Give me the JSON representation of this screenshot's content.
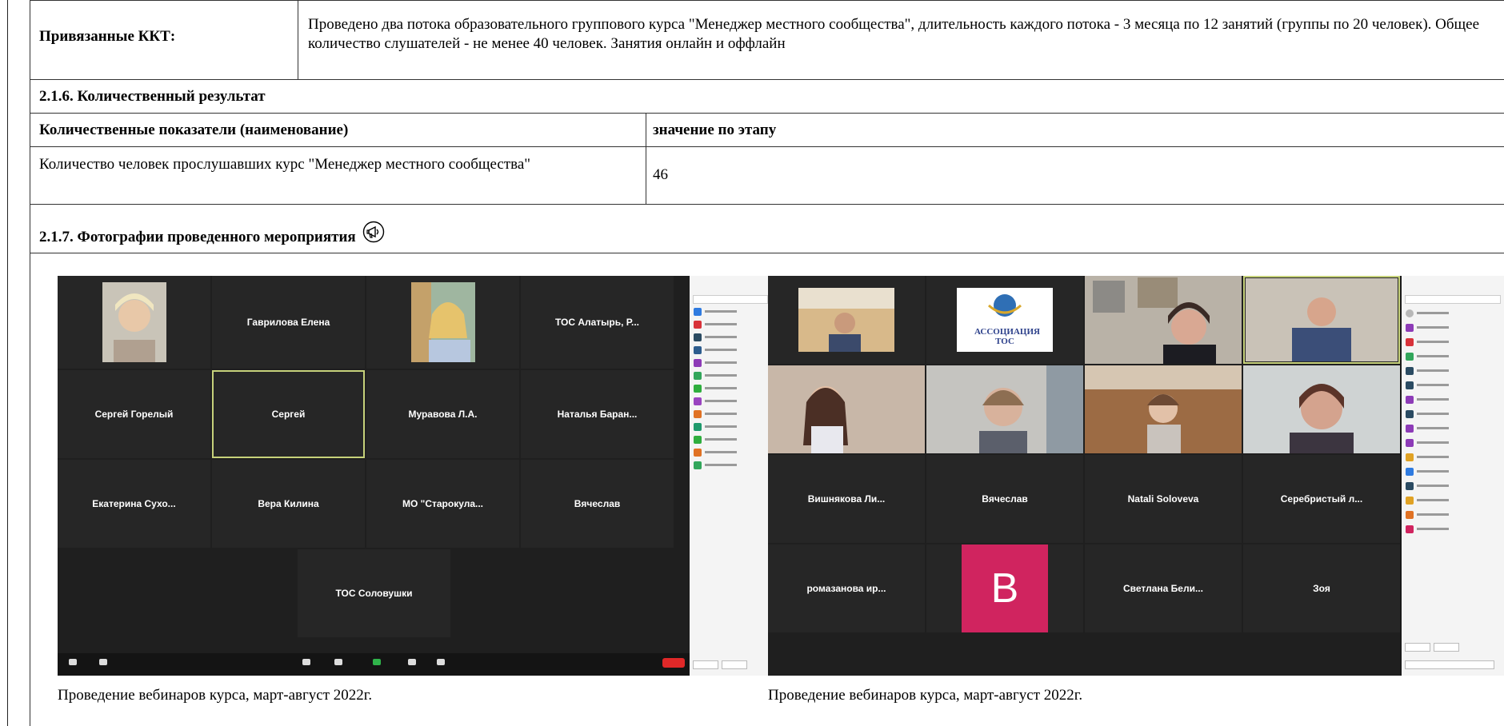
{
  "kkt": {
    "label": "Привязанные ККТ:",
    "text": "Проведено два потока образовательного группового курса \"Менеджер местного сообщества\", длительность каждого потока - 3 месяца по 12 занятий (группы по 20 человек). Общее количество слушателей - не менее 40 человек. Занятия онлайн и оффлайн"
  },
  "section_216": {
    "title": "2.1.6. Количественный результат"
  },
  "indicators": {
    "header_name": "Количественные показатели (наименование)",
    "header_value": "значение по этапу",
    "rows": [
      {
        "name": "Количество человек прослушавших курс \"Менеджер местного сообщества\"",
        "value": "46"
      }
    ]
  },
  "section_217": {
    "title": "2.1.7. Фотографии проведенного мероприятия",
    "icon": "megaphone-icon"
  },
  "photos": [
    {
      "caption": "Проведение вебинаров курса, март-август 2022г.",
      "tiles": [
        {
          "name": "",
          "kind": "camera"
        },
        {
          "name": "Гаврилова Елена",
          "kind": "name"
        },
        {
          "name": "",
          "kind": "camera"
        },
        {
          "name": "ТОС Алатырь, Р...",
          "kind": "name"
        },
        {
          "name": "Сергей Горелый",
          "kind": "name"
        },
        {
          "name": "Сергей",
          "kind": "name",
          "active": true
        },
        {
          "name": "Муравова Л.А.",
          "kind": "name"
        },
        {
          "name": "Наталья Баран...",
          "kind": "name"
        },
        {
          "name": "Екатерина Сухо...",
          "kind": "name"
        },
        {
          "name": "Вера Килина",
          "kind": "name"
        },
        {
          "name": "МО \"Старокула...",
          "kind": "name"
        },
        {
          "name": "Вячеслав",
          "kind": "name"
        },
        {
          "name": "ТОС Соловушки",
          "kind": "name"
        }
      ]
    },
    {
      "caption": "Проведение вебинаров курса, март-август 2022г.",
      "tiles": [
        {
          "name": "",
          "kind": "camera"
        },
        {
          "name": "",
          "kind": "logo",
          "logo_text": "АССОЦИАЦИЯ ТОС"
        },
        {
          "name": "",
          "kind": "camera"
        },
        {
          "name": "",
          "kind": "camera",
          "active": true
        },
        {
          "name": "",
          "kind": "camera"
        },
        {
          "name": "",
          "kind": "camera"
        },
        {
          "name": "",
          "kind": "camera"
        },
        {
          "name": "",
          "kind": "camera"
        },
        {
          "name": "Вишнякова Ли...",
          "kind": "name"
        },
        {
          "name": "Вячеслав",
          "kind": "name"
        },
        {
          "name": "Natali Soloveva",
          "kind": "name"
        },
        {
          "name": "Серебристый л...",
          "kind": "name"
        },
        {
          "name": "ромазанова ир...",
          "kind": "name"
        },
        {
          "name": "",
          "kind": "avatar",
          "letter": "B"
        },
        {
          "name": "Светлана Бели...",
          "kind": "name"
        },
        {
          "name": "Зоя",
          "kind": "name"
        }
      ]
    }
  ],
  "colors": {
    "accent_active": "#c6d17a",
    "avatar_b": "#d0245f",
    "leave": "#e02828"
  }
}
